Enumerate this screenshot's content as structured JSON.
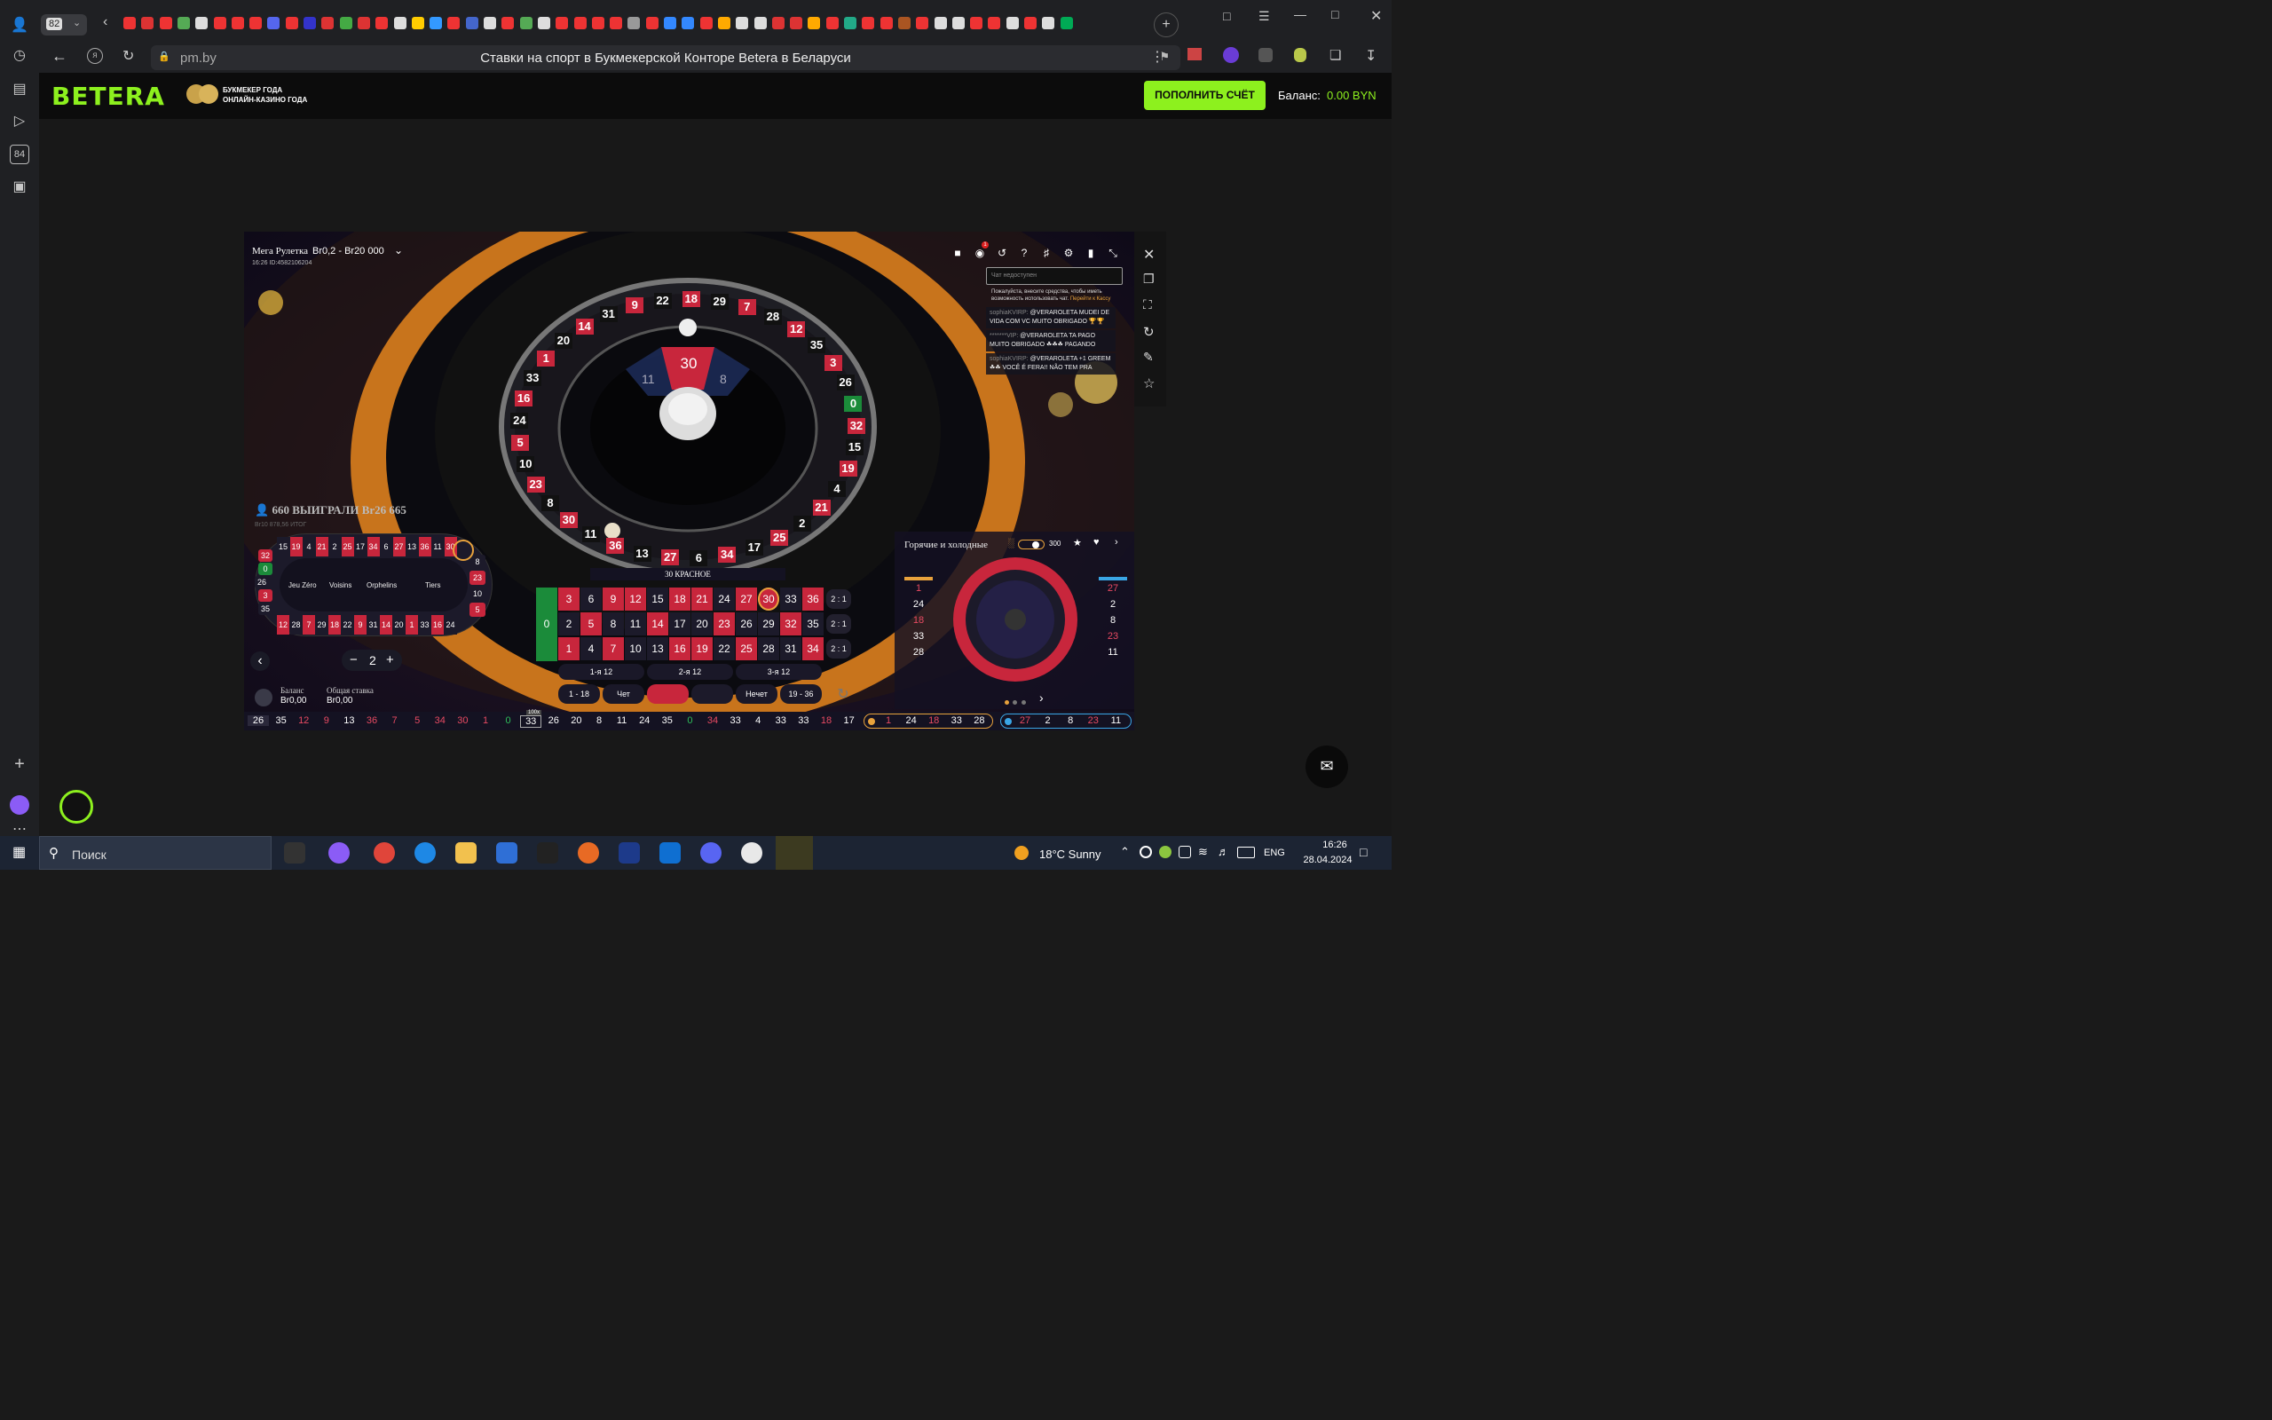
{
  "browser": {
    "tab_counter": "82",
    "url": "pm.by",
    "page_title": "Ставки на спорт в Букмекерской Конторе Betera в Беларуси",
    "sidebar_badge": "84"
  },
  "site": {
    "logo": "BETERA",
    "award_line1": "БУКМЕКЕР ГОДА",
    "award_line2": "ОНЛАЙН-КАЗИНО ГОДА",
    "deposit_button": "ПОПОЛНИТЬ СЧЁТ",
    "balance_label": "Баланс:",
    "balance_value": "0.00 BYN",
    "accent_color": "#8df01e"
  },
  "game": {
    "table_name": "Мега Рулетка",
    "limits": "Br0,2 - Br20 000",
    "time_id": "16:26 ID:4582106204",
    "chat_placeholder": "Чат недоступен",
    "chat_notice": "Пожалуйста, внесите средства, чтобы иметь возможность использовать чат.",
    "chat_notice_link": "Перейти к Кассу",
    "chat_messages": [
      {
        "user": "sophiaKVIRP:",
        "text": "@VERAROLETA MUDEI DE VIDA COM VC MUITO OBRIGADO 🏆🏆"
      },
      {
        "user": "*******VIP:",
        "text": "@VERAROLETA TA PAGO MUITO OBRIGADO ☘☘☘ PAGANDO"
      },
      {
        "user": "sophiaKVIRP:",
        "text": "@VERAROLETA +1 GREEM ☘☘ VOCÊ É FERA!! NÃO TEM PRA"
      }
    ],
    "result_number": "30",
    "result_left": "11",
    "result_right": "8",
    "result_caption": "30 КРАСНОЕ",
    "winners": "660 ВЫИГРАЛИ Br26 665",
    "winners_sub": "Br10 878,56 ИТОГ",
    "racetrack": {
      "top": [
        "15",
        "19",
        "4",
        "21",
        "2",
        "25",
        "17",
        "34",
        "6",
        "27",
        "13",
        "36",
        "11",
        "30"
      ],
      "bottom": [
        "12",
        "28",
        "7",
        "29",
        "18",
        "22",
        "9",
        "31",
        "14",
        "20",
        "1",
        "33",
        "16",
        "24"
      ],
      "left": [
        "32",
        "0",
        "26",
        "3",
        "35"
      ],
      "right": [
        "8",
        "23",
        "10",
        "5"
      ],
      "sections": [
        "Jeu Zéro",
        "Voisins",
        "Orphelins",
        "Tiers"
      ]
    },
    "stepper_value": "2",
    "board": {
      "zero": "0",
      "row1": [
        "3",
        "6",
        "9",
        "12",
        "15",
        "18",
        "21",
        "24",
        "27",
        "30",
        "33",
        "36"
      ],
      "row2": [
        "2",
        "5",
        "8",
        "11",
        "14",
        "17",
        "20",
        "23",
        "26",
        "29",
        "32",
        "35"
      ],
      "row3": [
        "1",
        "4",
        "7",
        "10",
        "13",
        "16",
        "19",
        "22",
        "25",
        "28",
        "31",
        "34"
      ],
      "reds": [
        "1",
        "3",
        "5",
        "7",
        "9",
        "12",
        "14",
        "16",
        "18",
        "19",
        "21",
        "23",
        "25",
        "27",
        "30",
        "32",
        "34",
        "36"
      ],
      "columns": [
        "2 : 1",
        "2 : 1",
        "2 : 1"
      ],
      "dozens": [
        "1-я 12",
        "2-я 12",
        "3-я 12"
      ],
      "outside": [
        "1 - 18",
        "Чет",
        "",
        "",
        "Нечет",
        "19 - 36"
      ]
    },
    "balance_label": "Баланс",
    "balance_value": "Br0,00",
    "total_bet_label": "Общая ставка",
    "total_bet_value": "Br0,00",
    "hot_cold_title": "Горячие и холодные",
    "hot_cold_count": "300",
    "hot_numbers": [
      "1",
      "24",
      "18",
      "33",
      "28"
    ],
    "cold_numbers": [
      "27",
      "2",
      "8",
      "23",
      "11"
    ],
    "history": [
      "26",
      "35",
      "12",
      "9",
      "13",
      "36",
      "7",
      "5",
      "34",
      "30",
      "1",
      "0",
      "33",
      "26",
      "20",
      "8",
      "11",
      "24",
      "35",
      "0",
      "34",
      "33",
      "4",
      "33",
      "33",
      "18",
      "17"
    ],
    "history_reds": [
      "12",
      "9",
      "36",
      "7",
      "5",
      "34",
      "30",
      "1",
      "18"
    ],
    "history_badge": "100x",
    "hot_strip": [
      "1",
      "24",
      "18",
      "33",
      "28"
    ],
    "cold_strip": [
      "27",
      "2",
      "8",
      "23",
      "11"
    ],
    "wheel_numbers": [
      "9",
      "22",
      "18",
      "29",
      "7",
      "28",
      "12",
      "35",
      "3",
      "26",
      "0",
      "32",
      "15",
      "19",
      "4",
      "21",
      "2",
      "25",
      "17",
      "34",
      "6",
      "27",
      "13",
      "36",
      "11",
      "30",
      "8",
      "23",
      "10",
      "5",
      "24",
      "16",
      "33",
      "1",
      "20",
      "14",
      "31"
    ]
  },
  "taskbar": {
    "search": "Поиск",
    "weather": "18°C  Sunny",
    "lang": "ENG",
    "time": "16:26",
    "date": "28.04.2024"
  }
}
